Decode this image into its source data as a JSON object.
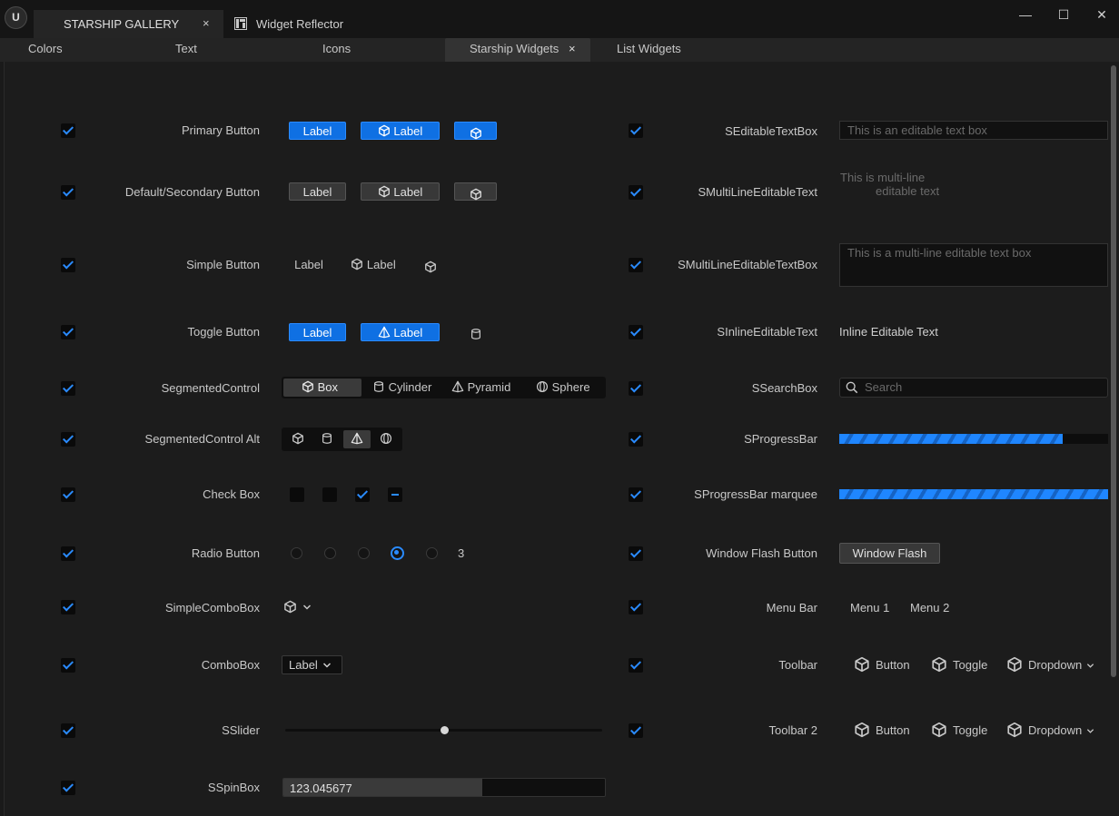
{
  "window": {
    "logo_text": "U",
    "tabs": [
      {
        "label": "STARSHIP GALLERY",
        "close": "×"
      },
      {
        "label": "Widget Reflector"
      }
    ],
    "controls": {
      "minimize": "—",
      "maximize": "☐",
      "close": "✕"
    }
  },
  "subtabs": [
    "Colors",
    "Text",
    "Icons",
    "Starship Widgets",
    "List Widgets"
  ],
  "subtab_close": "×",
  "left_rows": {
    "primary_button": "Primary Button",
    "default_button": "Default/Secondary Button",
    "simple_button": "Simple Button",
    "toggle_button": "Toggle Button",
    "segmented": "SegmentedControl",
    "segmented_alt": "SegmentedControl Alt",
    "check_box": "Check Box",
    "radio_button": "Radio Button",
    "simple_combo": "SimpleComboBox",
    "combo": "ComboBox",
    "slider": "SSlider",
    "spinbox": "SSpinBox"
  },
  "button_label": "Label",
  "segments": [
    "Box",
    "Cylinder",
    "Pyramid",
    "Sphere"
  ],
  "radio_value": "3",
  "combo_value": "Label",
  "slider_value": 0.5,
  "spin_value": "123.045677",
  "spin_fill": 0.62,
  "right_rows": {
    "editable_text_box": "SEditableTextBox",
    "multiline_text": "SMultiLineEditableText",
    "multiline_text_box": "SMultiLineEditableTextBox",
    "inline_text": "SInlineEditableText",
    "search_box": "SSearchBox",
    "progress": "SProgressBar",
    "progress_marquee": "SProgressBar marquee",
    "window_flash": "Window Flash Button",
    "menu_bar": "Menu Bar",
    "toolbar": "Toolbar",
    "toolbar2": "Toolbar 2"
  },
  "editable_placeholder": "This is an editable text box",
  "multiline_line1": "This is multi-line",
  "multiline_line2": "editable text",
  "multiline_box_placeholder": "This is a multi-line editable text box",
  "inline_text_value": "Inline Editable Text",
  "search_placeholder": "Search",
  "progress_value": 0.83,
  "window_flash_label": "Window Flash",
  "menus": [
    "Menu 1",
    "Menu 2"
  ],
  "toolbar_items": [
    "Button",
    "Toggle",
    "Dropdown"
  ],
  "colors": {
    "accent": "#0f70e3",
    "background": "#1c1c1c"
  }
}
